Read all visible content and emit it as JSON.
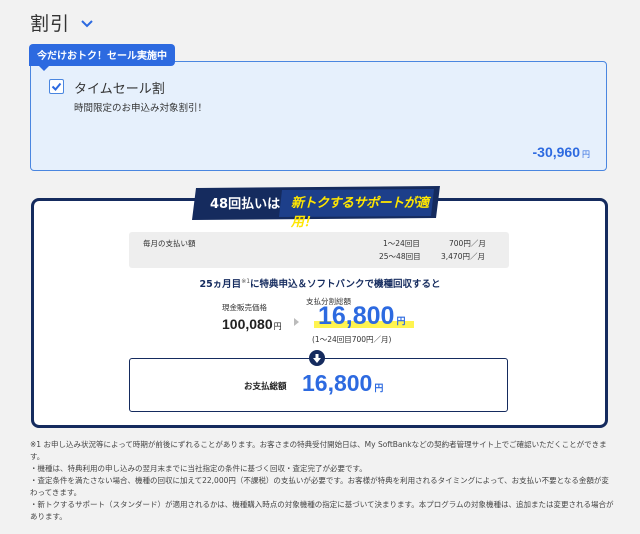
{
  "section": {
    "title": "割引"
  },
  "sale": {
    "tag": "今だけおトク！セール実施中",
    "option_label": "タイムセール割",
    "option_desc": "時間限定のお申込み対象割引！",
    "amount": "-30,960",
    "amount_unit": "円",
    "checked": true
  },
  "support": {
    "banner_count": "48回払いは",
    "banner_main": "新トクするサポートが適用！",
    "monthly_label": "毎月の支払い額",
    "monthly_rows": [
      {
        "range": "1〜24回目",
        "amount": "700円／月"
      },
      {
        "range": "25〜48回目",
        "amount": "3,470円／月"
      }
    ],
    "headline_a": "25ヵ月目",
    "headline_note": "※1",
    "headline_b": "に特典申込＆ソフトバンクで機種回収すると",
    "cash_label": "現金販売価格",
    "cash_value": "100,080",
    "cash_unit": "円",
    "installment_label": "支払分割総額",
    "installment_value": "16,800",
    "installment_unit": "円",
    "installment_note": "(1〜24回目700円／月)",
    "total_label": "お支払総額",
    "total_value": "16,800",
    "total_unit": "円"
  },
  "notes": [
    "※1 お申し込み状況等によって時期が前後にずれることがあります。お客さまの特典受付開始日は、My SoftBankなどの契約者管理サイト上でご確認いただくことができます。",
    "・機種は、特典利用の申し込みの翌月末までに当社指定の条件に基づく回収・査定完了が必要です。",
    "・査定条件を満たさない場合、機種の回収に加えて22,000円（不課税）の支払いが必要です。お客様が特典を利用されるタイミングによって、お支払い不要となる金額が変わってきます。",
    "・新トクするサポート（スタンダード）が適用されるかは、機種購入時点の対象機種の指定に基づいて決まります。本プログラムの対象機種は、追加または変更される場合があります。"
  ],
  "colors": {
    "accent": "#2d6ae0",
    "navy": "#152b5e",
    "highlight": "#fff44f"
  }
}
